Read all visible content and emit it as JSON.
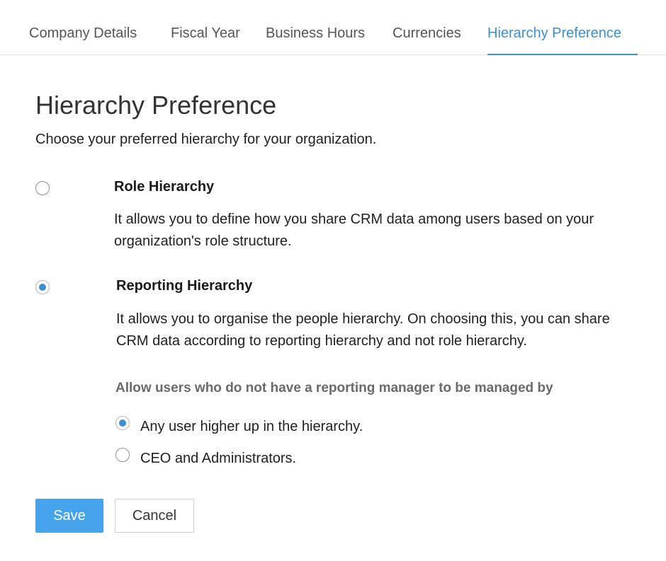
{
  "tabs": [
    {
      "label": "Company Details",
      "active": false
    },
    {
      "label": "Fiscal Year",
      "active": false
    },
    {
      "label": "Business Hours",
      "active": false
    },
    {
      "label": "Currencies",
      "active": false
    },
    {
      "label": "Hierarchy Preference",
      "active": true
    }
  ],
  "page": {
    "title": "Hierarchy Preference",
    "subtitle": "Choose your preferred hierarchy for your organization."
  },
  "options": {
    "role": {
      "label": "Role Hierarchy",
      "description": "It allows you to define how you share CRM data among users based on your organization's role structure.",
      "selected": false
    },
    "reporting": {
      "label": "Reporting Hierarchy",
      "description": "It allows you to organise the people hierarchy. On choosing this, you can share CRM data according to reporting hierarchy and not role hierarchy.",
      "selected": true
    }
  },
  "manager_setting": {
    "heading": "Allow users who do not have a reporting manager to be managed by",
    "choices": [
      {
        "label": "Any user higher up in the hierarchy.",
        "selected": true
      },
      {
        "label": "CEO and Administrators.",
        "selected": false
      }
    ]
  },
  "actions": {
    "save_label": "Save",
    "cancel_label": "Cancel"
  },
  "colors": {
    "accent": "#3b8fd6",
    "save_button": "#44a3ea"
  }
}
